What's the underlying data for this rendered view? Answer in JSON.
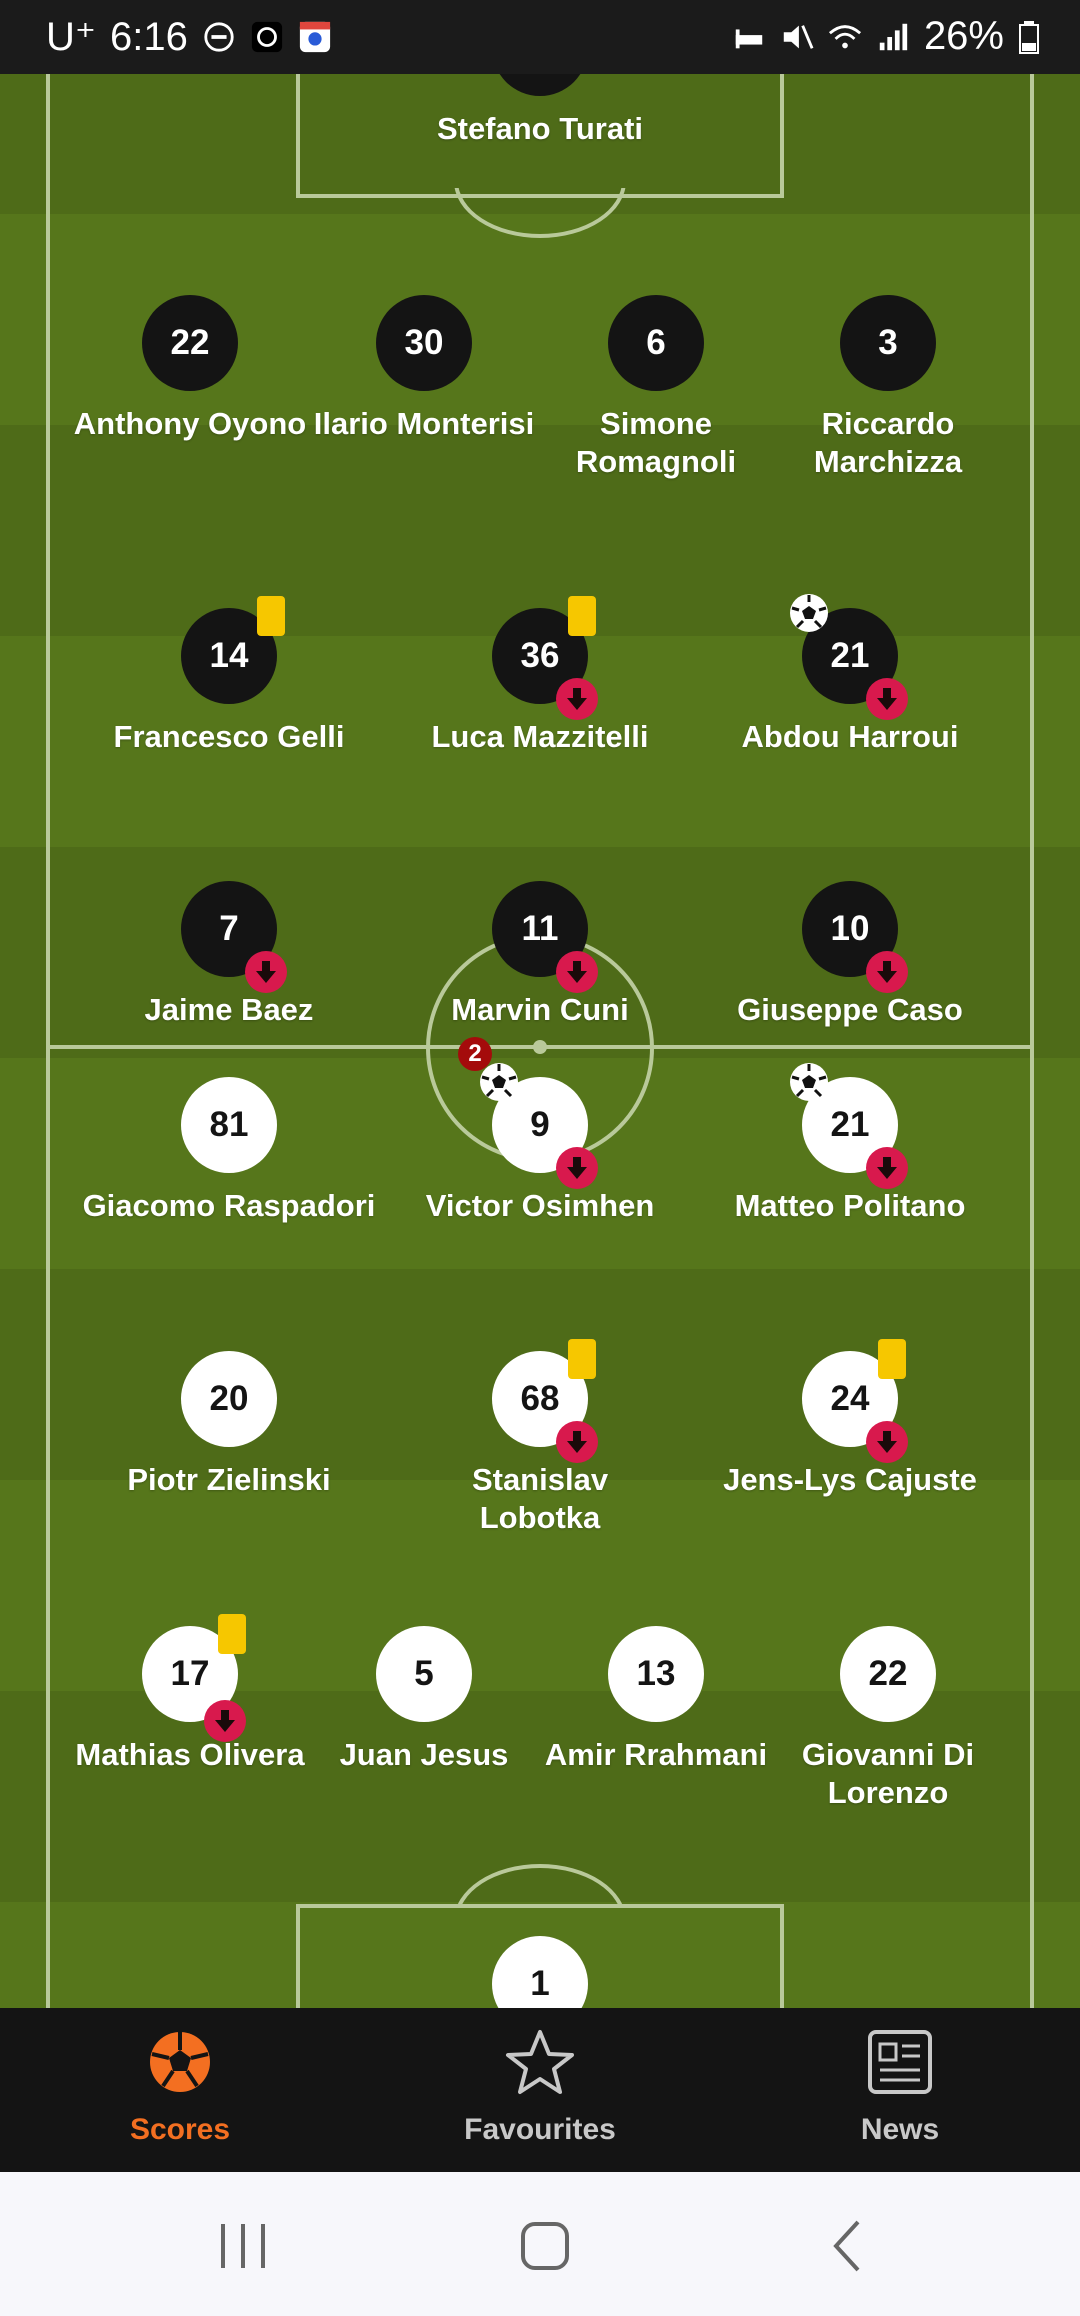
{
  "status_bar": {
    "carrier": "U⁺",
    "time": "6:16",
    "battery": "26%"
  },
  "lineup": {
    "home_goalkeeper": {
      "number": "",
      "name": "Stefano Turati"
    },
    "home_defenders": [
      {
        "number": "22",
        "name": "Anthony Oyono"
      },
      {
        "number": "30",
        "name": "Ilario Monterisi"
      },
      {
        "number": "6",
        "name": "Simone Romagnoli"
      },
      {
        "number": "3",
        "name": "Riccardo Marchizza"
      }
    ],
    "home_midfielders": [
      {
        "number": "14",
        "name": "Francesco Gelli"
      },
      {
        "number": "36",
        "name": "Luca Mazzitelli"
      },
      {
        "number": "21",
        "name": "Abdou Harroui"
      }
    ],
    "home_forwards": [
      {
        "number": "7",
        "name": "Jaime Baez"
      },
      {
        "number": "11",
        "name": "Marvin Cuni"
      },
      {
        "number": "10",
        "name": "Giuseppe Caso"
      }
    ],
    "away_forwards": [
      {
        "number": "81",
        "name": "Giacomo Raspadori"
      },
      {
        "number": "9",
        "name": "Victor Osimhen",
        "goals": "2"
      },
      {
        "number": "21",
        "name": "Matteo Politano"
      }
    ],
    "away_midfielders": [
      {
        "number": "20",
        "name": "Piotr Zielinski"
      },
      {
        "number": "68",
        "name": "Stanislav Lobotka"
      },
      {
        "number": "24",
        "name": "Jens-Lys Cajuste"
      }
    ],
    "away_defenders": [
      {
        "number": "17",
        "name": "Mathias Olivera"
      },
      {
        "number": "5",
        "name": "Juan Jesus"
      },
      {
        "number": "13",
        "name": "Amir Rrahmani"
      },
      {
        "number": "22",
        "name": "Giovanni Di Lorenzo"
      }
    ],
    "away_goalkeeper": {
      "number": "1",
      "name": ""
    }
  },
  "bottom_nav": {
    "items": [
      {
        "label": "Scores",
        "icon": "soccer-ball-icon",
        "active": true,
        "color": "#f36f21"
      },
      {
        "label": "Favourites",
        "icon": "star-icon",
        "active": false,
        "color": "#c8c8c8"
      },
      {
        "label": "News",
        "icon": "newspaper-icon",
        "active": false,
        "color": "#c8c8c8"
      }
    ]
  },
  "colors": {
    "accent": "#f36f21",
    "substitution": "#d8194d",
    "yellow_card": "#f6c700",
    "pitch": "#537219"
  }
}
